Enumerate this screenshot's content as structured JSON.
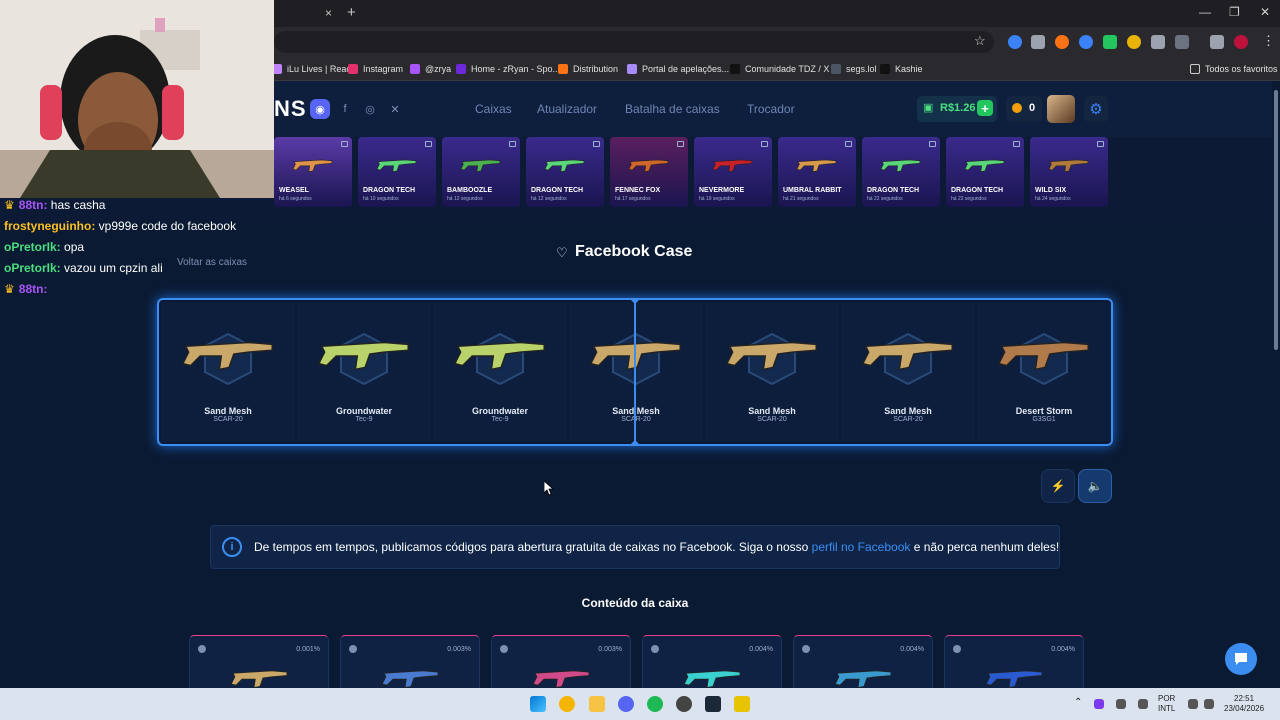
{
  "browser": {
    "tab_close": "×",
    "new_tab": "+",
    "win_min": "—",
    "win_max": "❐",
    "win_close": "✕",
    "bookmarks": [
      {
        "label": "iLu Lives | React",
        "color": "#c084fc"
      },
      {
        "label": "Instagram",
        "color": "#e1306c"
      },
      {
        "label": "@zrya",
        "color": "#a855f7"
      },
      {
        "label": "Home - zRyan - Spo...",
        "color": "#6d28d9"
      },
      {
        "label": "Distribution",
        "color": "#f97316"
      },
      {
        "label": "Portal de apelações...",
        "color": "#a78bfa"
      },
      {
        "label": "Comunidade TDZ / X",
        "color": "#111111"
      },
      {
        "label": "segs.lol",
        "color": "#4b5563"
      },
      {
        "label": "Kashie",
        "color": "#111111"
      }
    ],
    "favorites_label": "Todos os favoritos"
  },
  "header": {
    "logo_fragment": "NS",
    "nav": [
      "Caixas",
      "Atualizador",
      "Batalha de caixas",
      "Trocador"
    ],
    "balance": "R$1.26",
    "balance_plus": "+",
    "coins": "0",
    "settings_icon": "⚙"
  },
  "recent_drops": [
    {
      "name": "WEASEL",
      "time": "há 6 segundos",
      "color": "#5b3ba8",
      "gun": "#e0924a"
    },
    {
      "name": "DRAGON TECH",
      "time": "há 10 segundos",
      "color": "#3a2a8c",
      "gun": "#5ad67a"
    },
    {
      "name": "BAMBOOZLE",
      "time": "há 12 segundos",
      "color": "#3a2a8c",
      "gun": "#4caf50"
    },
    {
      "name": "DRAGON TECH",
      "time": "há 12 segundos",
      "color": "#3a2a8c",
      "gun": "#5ad67a"
    },
    {
      "name": "FENNEC FOX",
      "time": "há 17 segundos",
      "color": "#5a1f5e",
      "gun": "#d0662a"
    },
    {
      "name": "NEVERMORE",
      "time": "há 19 segundos",
      "color": "#3a2a8c",
      "gun": "#c8202a"
    },
    {
      "name": "UMBRAL RABBIT",
      "time": "há 21 segundos",
      "color": "#3a2a8c",
      "gun": "#d89a4a"
    },
    {
      "name": "DRAGON TECH",
      "time": "há 22 segundos",
      "color": "#3a2a8c",
      "gun": "#5ad67a"
    },
    {
      "name": "DRAGON TECH",
      "time": "há 22 segundos",
      "color": "#3a2a8c",
      "gun": "#5ad67a"
    },
    {
      "name": "WILD SIX",
      "time": "há 24 segundos",
      "color": "#3a2a8c",
      "gun": "#b07a3a"
    }
  ],
  "chat": [
    {
      "user": "88tn:",
      "text": " has casha",
      "color": "#a855f7",
      "crown": true
    },
    {
      "user": "frostyneguinho:",
      "text": " vp999e code do facebook",
      "color": "#fbbf24",
      "crown": false
    },
    {
      "user": "oPretorIk:",
      "text": " opa",
      "color": "#4ade80",
      "crown": false
    },
    {
      "user": "oPretorIk:",
      "text": " vazou um cpzin ali",
      "color": "#4ade80",
      "crown": false
    },
    {
      "user": "88tn:",
      "text": "",
      "color": "#a855f7",
      "crown": true
    }
  ],
  "crown_icon": "♛",
  "back_link": "Voltar as caixas",
  "case_title": "Facebook Case",
  "roulette": [
    {
      "name": "Sand Mesh",
      "weapon": "SCAR-20",
      "gun": "#c9a86a"
    },
    {
      "name": "Groundwater",
      "weapon": "Tec-9",
      "gun": "#b9d36a"
    },
    {
      "name": "Groundwater",
      "weapon": "Tec-9",
      "gun": "#b9d36a"
    },
    {
      "name": "Sand Mesh",
      "weapon": "SCAR-20",
      "gun": "#c9a86a"
    },
    {
      "name": "Sand Mesh",
      "weapon": "SCAR-20",
      "gun": "#c9a86a"
    },
    {
      "name": "Sand Mesh",
      "weapon": "SCAR-20",
      "gun": "#c9a86a"
    },
    {
      "name": "Desert Storm",
      "weapon": "G3SG1",
      "gun": "#b07a4a"
    }
  ],
  "info": {
    "icon": "i",
    "text_before": "De tempos em tempos, publicamos códigos para abertura gratuita de caixas no Facebook. Siga o nosso ",
    "link": "perfil no Facebook",
    "text_after": " e não perca nenhum deles!"
  },
  "content_title": "Conteúdo da caixa",
  "contents": [
    {
      "pct": "0.001%",
      "gun": "#c9a86a",
      "accent": "#e83e8c"
    },
    {
      "pct": "0.003%",
      "gun": "#4a7ad0",
      "accent": "#e83e8c"
    },
    {
      "pct": "0.003%",
      "gun": "#d04a8a",
      "accent": "#e83e8c"
    },
    {
      "pct": "0.004%",
      "gun": "#3ad0d0",
      "accent": "#e83e8c"
    },
    {
      "pct": "0.004%",
      "gun": "#3a9ad0",
      "accent": "#e83e8c"
    },
    {
      "pct": "0.004%",
      "gun": "#2a5ad0",
      "accent": "#e83e8c"
    }
  ],
  "taskbar": {
    "lang_top": "POR",
    "lang_bottom": "INTL",
    "time": "22:51",
    "date": "23/04/2026"
  }
}
